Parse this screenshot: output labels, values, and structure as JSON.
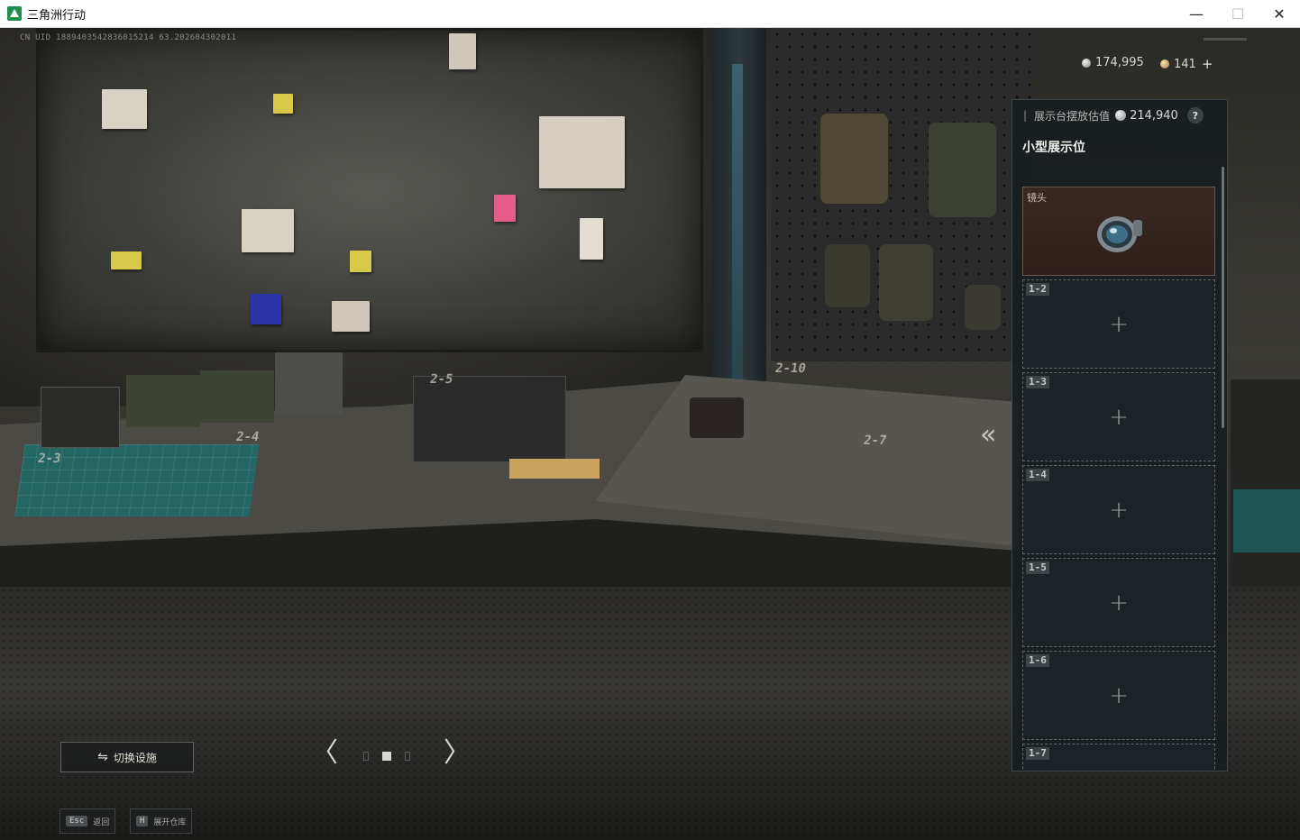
{
  "window": {
    "title": "三角洲行动",
    "minimize": "—",
    "maximize": "☐",
    "close": "✕"
  },
  "hud": {
    "uid": "CN UID 1889403542836015214 63.202604302011",
    "currency_silver": "174,995",
    "currency_gold": "141",
    "currency_add": "+"
  },
  "scene": {
    "desk_slots": [
      "2-3",
      "2-4",
      "2-5",
      "2-10",
      "2-7"
    ],
    "collapse": "«"
  },
  "panel": {
    "header_label": "展示台摆放估值",
    "header_value": "214,940",
    "help": "?",
    "section_title": "小型展示位",
    "slots": [
      {
        "label": "",
        "item": "镜头",
        "filled": true
      },
      {
        "label": "1-2",
        "item": "",
        "filled": false
      },
      {
        "label": "1-3",
        "item": "",
        "filled": false
      },
      {
        "label": "1-4",
        "item": "",
        "filled": false
      },
      {
        "label": "1-5",
        "item": "",
        "filled": false
      },
      {
        "label": "1-6",
        "item": "",
        "filled": false
      },
      {
        "label": "1-7",
        "item": "",
        "filled": false
      }
    ],
    "plus": "+"
  },
  "controls": {
    "switch_label": "切换设施",
    "switch_icon": "⇋",
    "prev": "〈",
    "next": "〉"
  },
  "hints": {
    "esc_key": "Esc",
    "esc_label": "返回",
    "h_key": "H",
    "h_label": "展开仓库"
  }
}
